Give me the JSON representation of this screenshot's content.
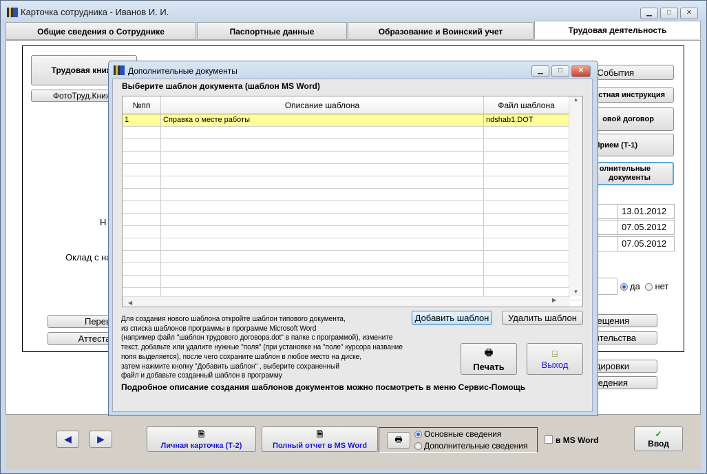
{
  "window": {
    "title": "Карточка сотрудника -  Иванов И. И."
  },
  "tabs": [
    {
      "label": "Общие сведения о Сотруднике"
    },
    {
      "label": "Паспортные данные"
    },
    {
      "label": "Образование и Воинский учет"
    },
    {
      "label": "Трудовая деятельность"
    }
  ],
  "left": {
    "labor_book": "Трудовая книжк",
    "photo_book": "ФотоТруд.Книжк",
    "label_n": "Н",
    "salary_label": "Оклад с на",
    "transfer": "Перево",
    "attestation": "Аттестац"
  },
  "right": {
    "events": "События",
    "instruction": "стная инструкция",
    "contract": "овой  договор",
    "hire": "Прием (Т-1)",
    "extra_docs_1": "олнительные",
    "extra_docs_2": "документы",
    "dates": [
      "13.01.2012",
      "07.05.2012",
      "07.05.2012"
    ],
    "radio_yes": "да",
    "radio_no": "нет",
    "btn1": "ещения",
    "btn2": "ительства",
    "btn3": "дировки",
    "btn4": "едения"
  },
  "dialog": {
    "title": "Дополнительные документы",
    "prompt": "Выберите шаблон документа (шаблон MS Word)",
    "columns": [
      "№пп",
      "Описание шаблона",
      "Файл шаблона"
    ],
    "rows": [
      {
        "num": "1",
        "desc": "Справка о месте работы",
        "file": "ndshab1.DOT"
      }
    ],
    "add_template": "Добавить шаблон",
    "delete_template": "Удалить шаблон",
    "help_lines": [
      "Для создания нового шаблона откройте шаблон типового документа,",
      "из списка шаблонов программы в программе Microsoft Word",
      "(например файл \"шаблон трудового договора.dot\" в папке  с программой),  измените",
      "текст, добавьте или удалите нужные \"поля\" (при установке на \"поле\" курсора название",
      "поля выделяется), после чего сохраните шаблон в любое место на диске,",
      "затем нажмите кнопку \"Добавить шаблон\" , выберите сохраненный",
      "файл и добавьте созданный шаблон в программу"
    ],
    "help_bold": "Подробное описание создания шаблонов документов можно посмотреть в меню Сервис-Помощь",
    "print": "Печать",
    "exit": "Выход"
  },
  "bottom": {
    "personal_card": "Личная карточка (Т-2)",
    "full_report": "Полный отчет в MS Word",
    "opt_main": "Основные сведения",
    "opt_extra": "Дополнительные сведения",
    "ms_word": "в MS Word",
    "enter": "Ввод"
  }
}
